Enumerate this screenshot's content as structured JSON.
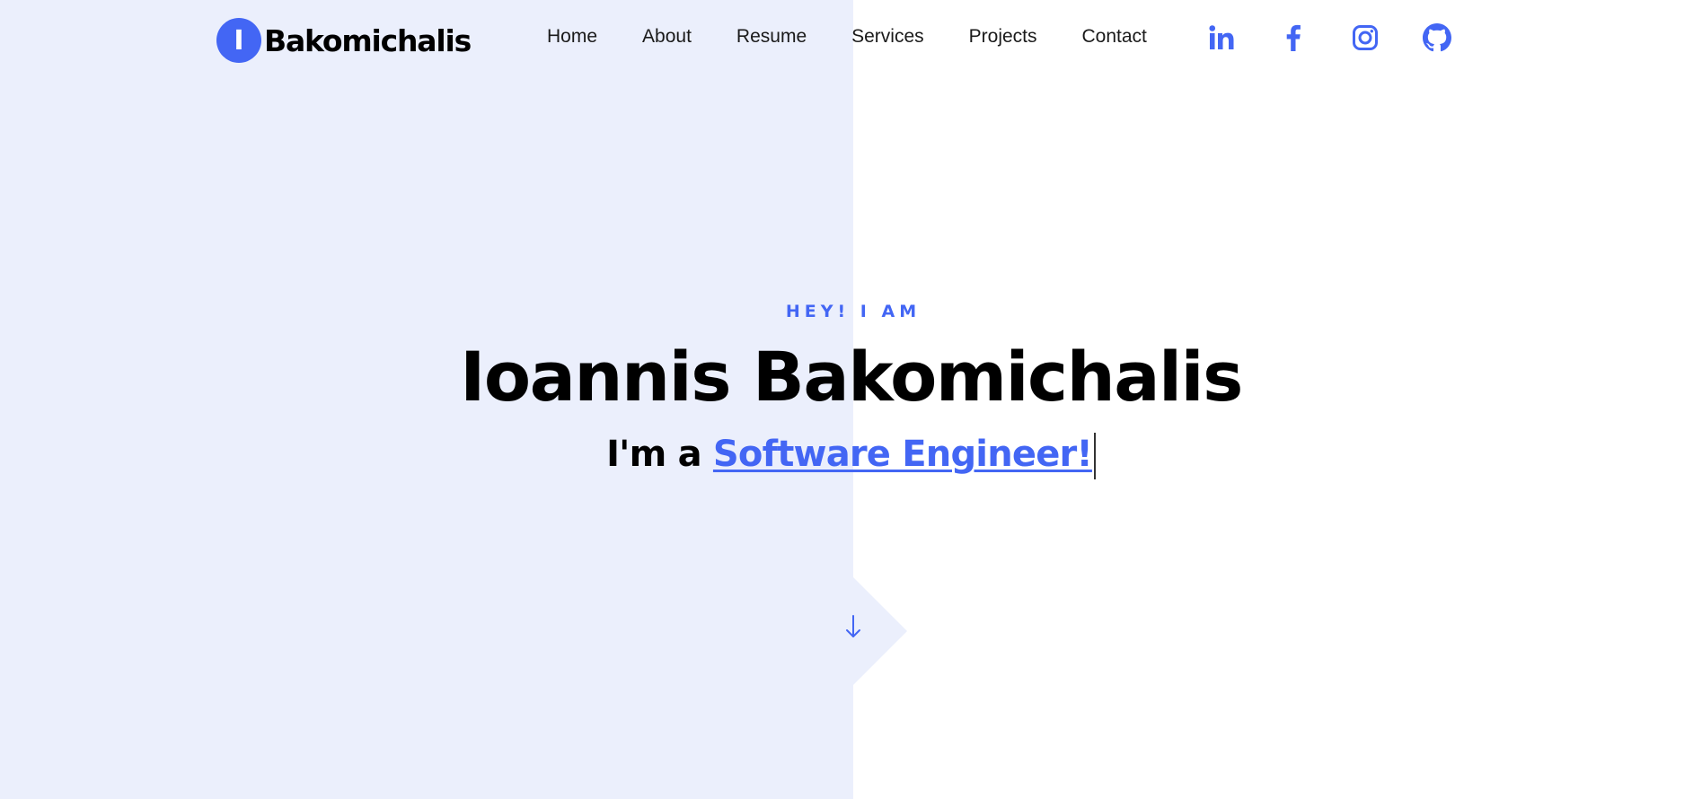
{
  "brand": {
    "logo_letter": "I",
    "logo_text": "Bakomichalis",
    "accent_color": "#4366f4",
    "panel_color": "#ebeffc"
  },
  "nav": {
    "items": [
      {
        "label": "Home"
      },
      {
        "label": "About"
      },
      {
        "label": "Resume"
      },
      {
        "label": "Services"
      },
      {
        "label": "Projects"
      },
      {
        "label": "Contact"
      }
    ]
  },
  "social": {
    "icons": [
      "linkedin-icon",
      "facebook-icon",
      "instagram-icon",
      "github-icon"
    ]
  },
  "hero": {
    "kicker": "HEY! I AM",
    "name": "Ioannis Bakomichalis",
    "tagline_prefix": "I'm a ",
    "tagline_role": "Software Engineer!"
  },
  "scroll": {
    "icon": "arrow-down-icon"
  }
}
